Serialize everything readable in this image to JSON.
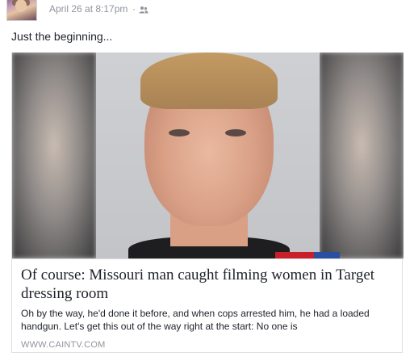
{
  "post": {
    "timestamp": "April 26 at 8:17pm",
    "separator": "·",
    "audience_icon": "friends-icon",
    "text": "Just the beginning..."
  },
  "link": {
    "title": "Of course: Missouri man caught filming women in Target dressing room",
    "description": "Oh by the way, he'd done it before, and when cops arrested him, he had a loaded handgun. Let's get this out of the way right at the start: No one is",
    "domain": "WWW.CAINTV.COM"
  },
  "colors": {
    "meta_text": "#90949c",
    "body_text": "#1d2129",
    "border": "#dddfe2"
  }
}
